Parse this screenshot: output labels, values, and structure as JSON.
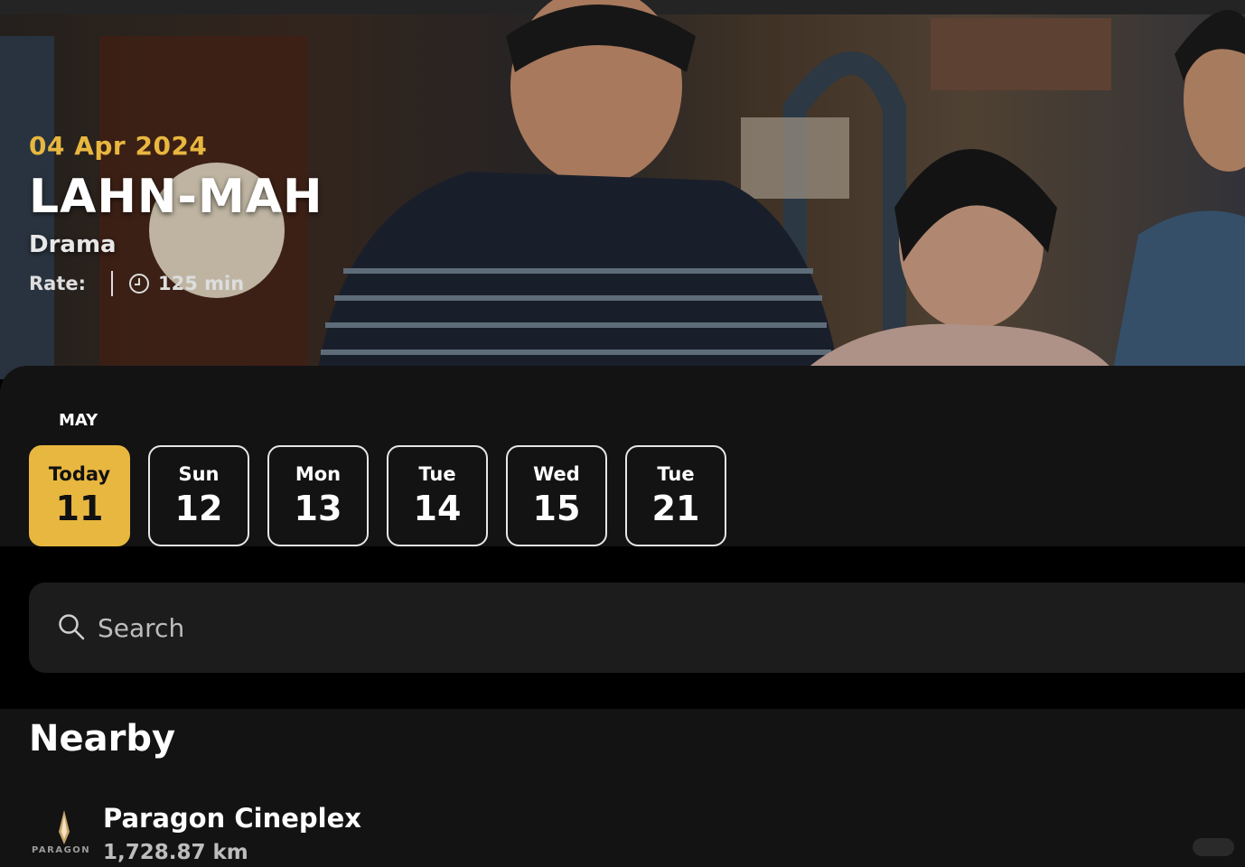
{
  "movie": {
    "release_date": "04 Apr 2024",
    "title": "LAHN-MAH",
    "genre": "Drama",
    "rate_label": "Rate:",
    "duration": "125 min"
  },
  "date_picker": {
    "month": "MAY",
    "dates": [
      {
        "dow": "Today",
        "day": "11",
        "selected": true
      },
      {
        "dow": "Sun",
        "day": "12",
        "selected": false
      },
      {
        "dow": "Mon",
        "day": "13",
        "selected": false
      },
      {
        "dow": "Tue",
        "day": "14",
        "selected": false
      },
      {
        "dow": "Wed",
        "day": "15",
        "selected": false
      },
      {
        "dow": "Tue",
        "day": "21",
        "selected": false
      }
    ]
  },
  "search": {
    "placeholder": "Search",
    "icon": "search-icon"
  },
  "nearby": {
    "heading": "Nearby",
    "cinemas": [
      {
        "name": "Paragon Cineplex",
        "distance": "1,728.87 km",
        "logo_text": "PARAGON"
      }
    ]
  },
  "colors": {
    "accent": "#e8b73f",
    "panel": "#131313",
    "search_bg": "#1c1c1c"
  }
}
